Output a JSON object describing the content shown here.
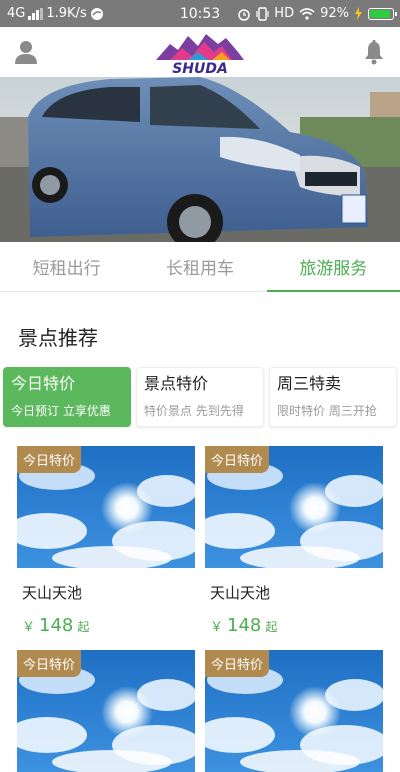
{
  "statusbar": {
    "network": "4G",
    "speed": "1.9K/s",
    "time": "10:53",
    "hd": "HD",
    "battery": "92%",
    "battery_level": 0.92
  },
  "header": {
    "logo_text": "SHUDA",
    "user_icon": "user-icon",
    "notify_icon": "bell-icon"
  },
  "tabs": [
    {
      "label": "短租出行",
      "active": false
    },
    {
      "label": "长租用车",
      "active": false
    },
    {
      "label": "旅游服务",
      "active": true
    }
  ],
  "section": {
    "title": "景点推荐"
  },
  "promos": [
    {
      "title": "今日特价",
      "subtitle": "今日预订 立享优惠",
      "active": true
    },
    {
      "title": "景点特价",
      "subtitle": "特价景点 先到先得",
      "active": false
    },
    {
      "title": "周三特卖",
      "subtitle": "限时特价 周三开抢",
      "active": false
    }
  ],
  "cards": [
    {
      "tag": "今日特价",
      "name": "天山天池",
      "currency": "￥",
      "price": "148",
      "unit": "起"
    },
    {
      "tag": "今日特价",
      "name": "天山天池",
      "currency": "￥",
      "price": "148",
      "unit": "起"
    },
    {
      "tag": "今日特价",
      "name": "",
      "currency": "",
      "price": "",
      "unit": ""
    },
    {
      "tag": "今日特价",
      "name": "",
      "currency": "",
      "price": "",
      "unit": ""
    }
  ],
  "colors": {
    "accent": "#4cae4f",
    "tag_bg": "#b08a4f",
    "statusbar": "#7a7a7a"
  }
}
